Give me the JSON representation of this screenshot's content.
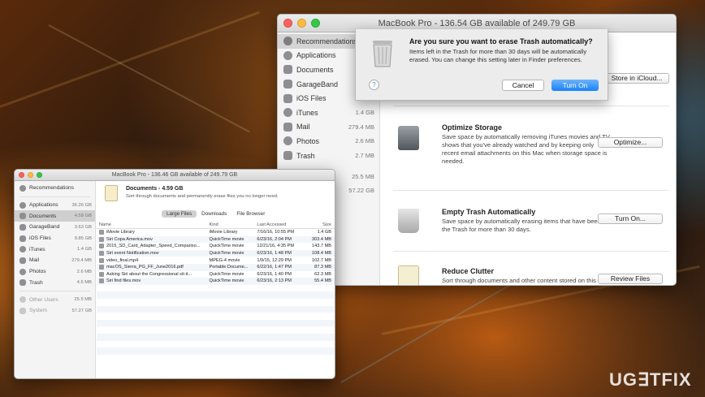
{
  "back_window": {
    "title": "MacBook Pro - 136.54 GB available of 249.79 GB",
    "sidebar": [
      {
        "label": "Recommendations",
        "size": ""
      },
      {
        "label": "Applications",
        "size": "36"
      },
      {
        "label": "Documents",
        "size": "4"
      },
      {
        "label": "GarageBand",
        "size": "3"
      },
      {
        "label": "iOS Files",
        "size": "9"
      },
      {
        "label": "iTunes",
        "size": "1.4 GB"
      },
      {
        "label": "Mail",
        "size": "279.4 MB"
      },
      {
        "label": "Photos",
        "size": "2.6 MB"
      },
      {
        "label": "Trash",
        "size": "2.7 MB"
      },
      {
        "label": "",
        "size": ""
      },
      {
        "label": "",
        "size": "25.5 MB"
      },
      {
        "label": "",
        "size": "57.22 GB"
      }
    ],
    "recommendations": [
      {
        "title": "",
        "desc": "",
        "button": "Store in iCloud..."
      },
      {
        "title": "Optimize Storage",
        "desc": "Save space by automatically removing iTunes movies and TV shows that you've already watched and by keeping only recent email attachments on this Mac when storage space is needed.",
        "button": "Optimize..."
      },
      {
        "title": "Empty Trash Automatically",
        "desc": "Save space by automatically erasing items that have been in the Trash for more than 30 days.",
        "button": "Turn On..."
      },
      {
        "title": "Reduce Clutter",
        "desc": "Sort through documents and other content stored on this Mac and delete what is no longer needed.",
        "button": "Review Files"
      }
    ]
  },
  "dialog": {
    "title": "Are you sure you want to erase Trash automatically?",
    "message": "Items left in the Trash for more than 30 days will be automatically erased. You can change this setting later in Finder preferences.",
    "help": "?",
    "cancel": "Cancel",
    "confirm": "Turn On"
  },
  "front_window": {
    "title": "MacBook Pro - 136.46 GB available of 249.79 GB",
    "sidebar": [
      {
        "label": "Recommendations",
        "size": ""
      },
      {
        "label": "Applications",
        "size": "36.26 GB"
      },
      {
        "label": "Documents",
        "size": "4.59 GB"
      },
      {
        "label": "GarageBand",
        "size": "3.63 GB"
      },
      {
        "label": "iOS Files",
        "size": "9.85 GB"
      },
      {
        "label": "iTunes",
        "size": "1.4 GB"
      },
      {
        "label": "Mail",
        "size": "279.4 MB"
      },
      {
        "label": "Photos",
        "size": "2.6 MB"
      },
      {
        "label": "Trash",
        "size": "4.6 MB"
      },
      {
        "label": "Other Users",
        "size": "25.5 MB"
      },
      {
        "label": "System",
        "size": "57.27 GB"
      }
    ],
    "header_title": "Documents - 4.59 GB",
    "header_subtitle": "Sort through documents and permanently erase files you no longer need.",
    "tabs": [
      "Large Files",
      "Downloads",
      "File Browser"
    ],
    "columns": [
      "Name",
      "Kind",
      "Last Accessed",
      "Size"
    ],
    "rows": [
      [
        "iMovie Library",
        "iMovie Library",
        "7/16/16, 10:55 PM",
        "1.4 GB"
      ],
      [
        "Siri Copa America.mov",
        "QuickTime movie",
        "6/23/16, 2:04 PM",
        "303.4 MB"
      ],
      [
        "2015_SD_Card_Adapter_Speed_Compariso...",
        "QuickTime movie",
        "12/21/16, 4:35 PM",
        "143.7 MB"
      ],
      [
        "Siri event Notification.mov",
        "QuickTime movie",
        "6/23/16, 1:48 PM",
        "108.4 MB"
      ],
      [
        "video_final.mp4",
        "MPEG-4 movie",
        "1/9/15, 12:29 PM",
        "102.7 MB"
      ],
      [
        "macOS_Sierra_PG_FF_June2016.pdf",
        "Portable Docume...",
        "6/22/16, 1:47 PM",
        "87.3 MB"
      ],
      [
        "Asking Siri about the Congressional sit-it...",
        "QuickTime movie",
        "6/23/16, 1:40 PM",
        "62.3 MB"
      ],
      [
        "Siri find files.mov",
        "QuickTime movie",
        "6/23/16, 2:13 PM",
        "55.4 MB"
      ]
    ]
  },
  "watermark": "UG∃TFIX"
}
